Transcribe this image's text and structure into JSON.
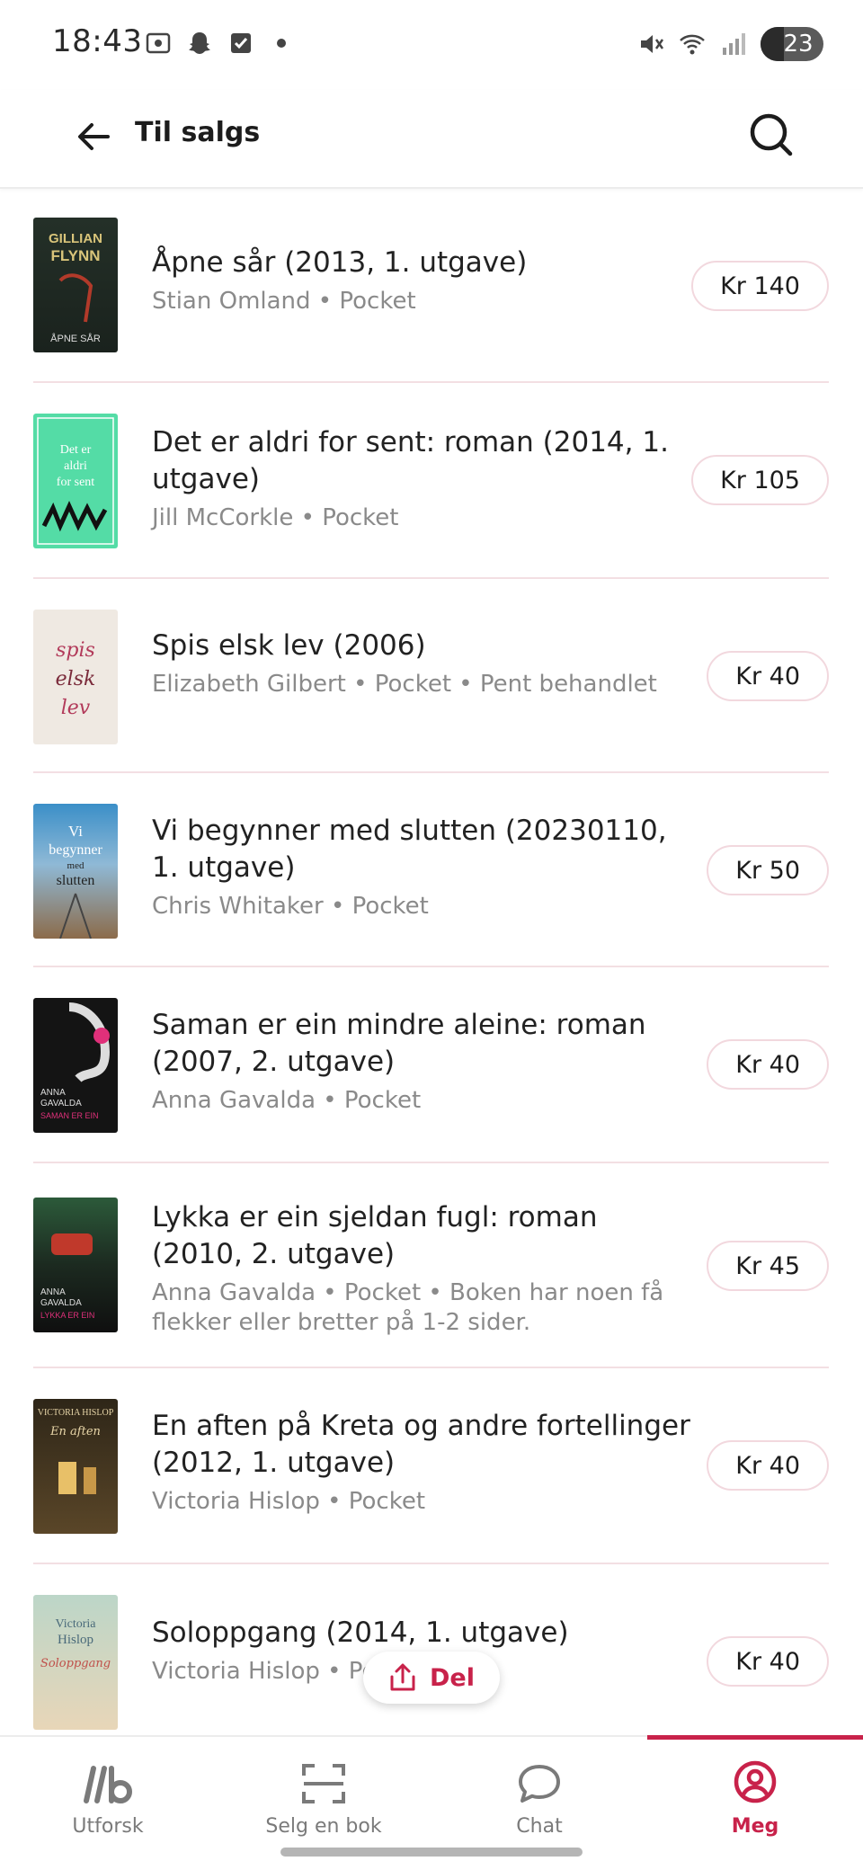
{
  "status_bar": {
    "time": "18:43",
    "battery": "23",
    "left_icons": [
      "screenshot-icon",
      "snapchat-icon",
      "checkbox-icon",
      "dot-icon"
    ],
    "right_icons": [
      "mute-icon",
      "wifi-icon",
      "signal-icon",
      "battery-icon"
    ]
  },
  "header": {
    "title": "Til salgs",
    "back_icon": "arrow-left-icon",
    "search_icon": "search-icon"
  },
  "listings": [
    {
      "title": "Åpne sår (2013, 1. utgave)",
      "subtitle": "Stian Omland • Pocket",
      "price": "Kr 140",
      "cover_colors": [
        "#1e2a24",
        "#3d5a3a"
      ],
      "cover_text": "GILLIAN FLYNN"
    },
    {
      "title": "Det er aldri for sent: roman (2014, 1. utgave)",
      "subtitle": "Jill McCorkle • Pocket",
      "price": "Kr 105",
      "cover_colors": [
        "#5ce1b0",
        "#3fc790"
      ],
      "cover_text": "Det er aldri for sent"
    },
    {
      "title": "Spis elsk lev (2006)",
      "subtitle": "Elizabeth Gilbert • Pocket • Pent behandlet",
      "price": "Kr 40",
      "cover_colors": [
        "#f4eee6",
        "#d9cfc3"
      ],
      "cover_text": "spis elsk lev"
    },
    {
      "title": "Vi begynner med slutten (20230110, 1. utgave)",
      "subtitle": "Chris Whitaker • Pocket",
      "price": "Kr 50",
      "cover_colors": [
        "#3b8fc8",
        "#8c6b4a"
      ],
      "cover_text": "Vi begynner med slutten"
    },
    {
      "title": "Saman er ein mindre aleine: roman (2007, 2. utgave)",
      "subtitle": "Anna Gavalda • Pocket",
      "price": "Kr 40",
      "cover_colors": [
        "#111111",
        "#2b2b2b"
      ],
      "cover_text": "ANNA GAVALDA"
    },
    {
      "title": "Lykka er ein sjeldan fugl: roman (2010, 2. utgave)",
      "subtitle": "Anna Gavalda • Pocket • Boken har noen få flekker eller bretter på 1-2 sider.",
      "price": "Kr 45",
      "cover_colors": [
        "#1f3a28",
        "#0f0f0f"
      ],
      "cover_text": "ANNA GAVALDA"
    },
    {
      "title": "En aften på Kreta og andre fortellinger (2012, 1. utgave)",
      "subtitle": "Victoria Hislop • Pocket",
      "price": "Kr 40",
      "cover_colors": [
        "#3a3020",
        "#6a5430"
      ],
      "cover_text": "VICTORIA HISLOP"
    },
    {
      "title": "Soloppgang (2014, 1. utgave)",
      "subtitle": "Victoria Hislop • Pocket",
      "price": "Kr 40",
      "cover_colors": [
        "#bfd8cc",
        "#e8d6b8"
      ],
      "cover_text": "Victoria Hislop"
    }
  ],
  "share_button": {
    "label": "Del",
    "icon": "share-icon"
  },
  "bottom_nav": [
    {
      "label": "Utforsk",
      "icon": "lb-logo-icon",
      "active": false
    },
    {
      "label": "Selg en bok",
      "icon": "scan-icon",
      "active": false
    },
    {
      "label": "Chat",
      "icon": "chat-bubble-icon",
      "active": false
    },
    {
      "label": "Meg",
      "icon": "profile-icon",
      "active": true
    }
  ],
  "colors": {
    "accent": "#c8224a",
    "divider": "#f3dfe3",
    "muted_text": "#8a8a8a"
  }
}
